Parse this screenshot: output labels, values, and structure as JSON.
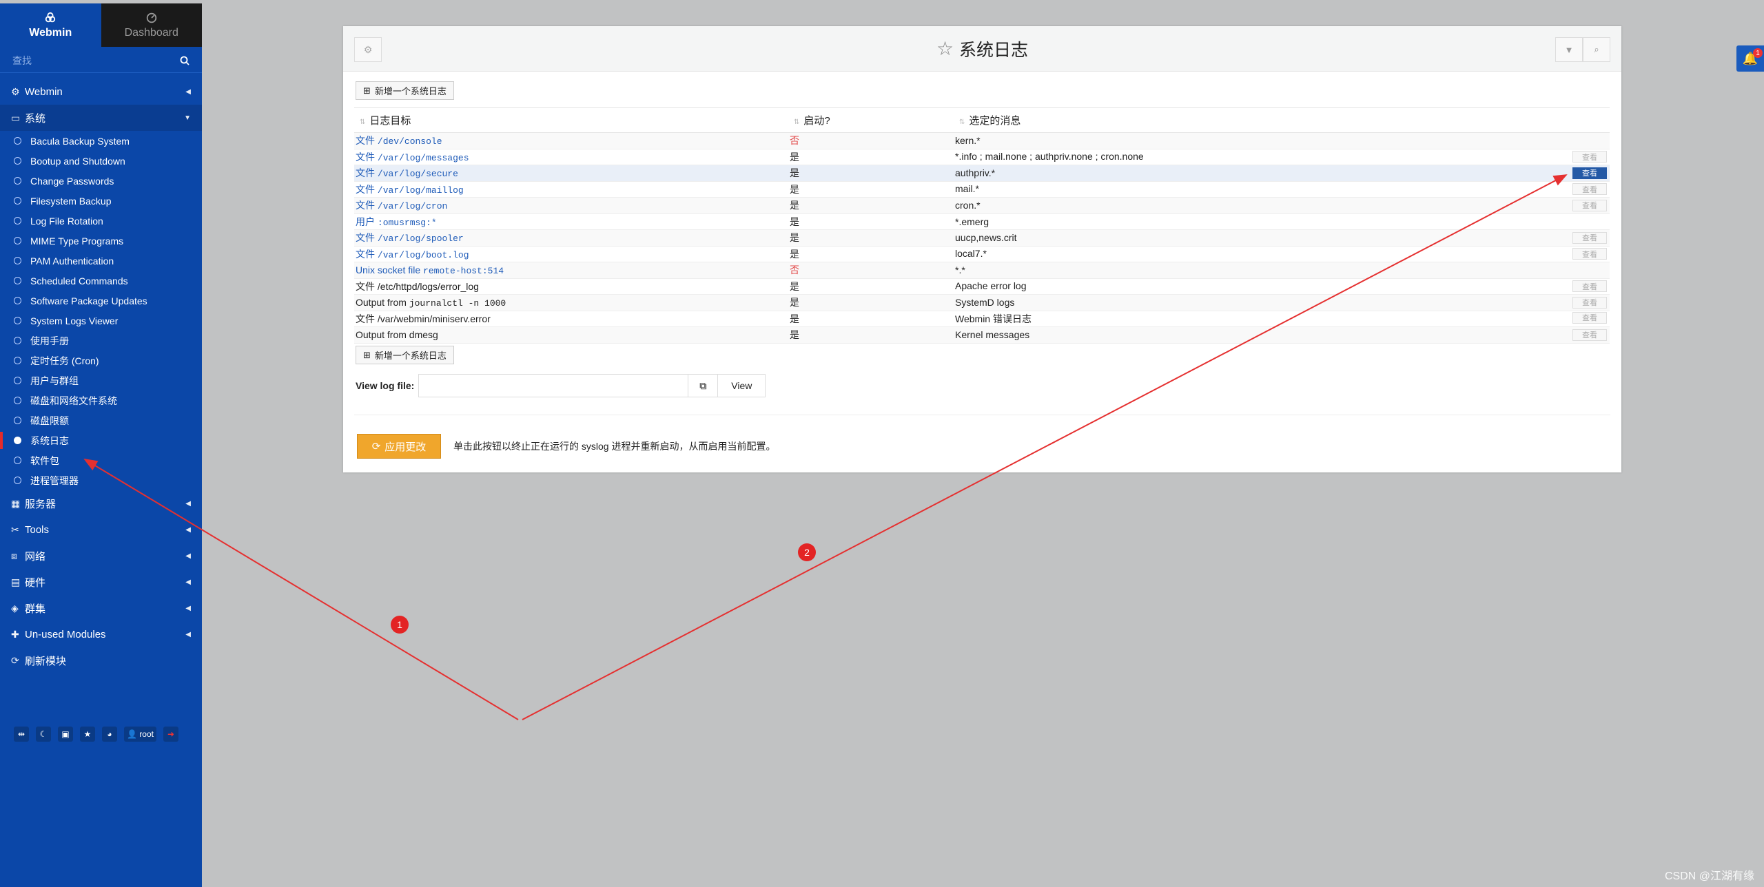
{
  "sidebar": {
    "tabs": [
      {
        "label": "Webmin"
      },
      {
        "label": "Dashboard"
      }
    ],
    "search_placeholder": "查找",
    "categories": [
      {
        "label": "Webmin",
        "icon": "gear-icon"
      },
      {
        "label": "系统",
        "icon": "monitor-icon"
      }
    ],
    "system_items": [
      {
        "label": "Bacula Backup System"
      },
      {
        "label": "Bootup and Shutdown"
      },
      {
        "label": "Change Passwords"
      },
      {
        "label": "Filesystem Backup"
      },
      {
        "label": "Log File Rotation"
      },
      {
        "label": "MIME Type Programs"
      },
      {
        "label": "PAM Authentication"
      },
      {
        "label": "Scheduled Commands"
      },
      {
        "label": "Software Package Updates"
      },
      {
        "label": "System Logs Viewer"
      },
      {
        "label": "使用手册"
      },
      {
        "label": "定时任务 (Cron)"
      },
      {
        "label": "用户与群组"
      },
      {
        "label": "磁盘和网络文件系统"
      },
      {
        "label": "磁盘限额"
      },
      {
        "label": "系统日志"
      },
      {
        "label": "软件包"
      },
      {
        "label": "进程管理器"
      }
    ],
    "other_categories": [
      {
        "label": "服务器",
        "icon": "server-icon"
      },
      {
        "label": "Tools",
        "icon": "tools-icon"
      },
      {
        "label": "网络",
        "icon": "network-icon"
      },
      {
        "label": "硬件",
        "icon": "hardware-icon"
      },
      {
        "label": "群集",
        "icon": "cluster-icon"
      },
      {
        "label": "Un-used Modules",
        "icon": "puzzle-icon"
      },
      {
        "label": "刷新模块",
        "icon": "refresh-icon"
      }
    ],
    "footer_user": "root"
  },
  "panel": {
    "title": "系统日志",
    "add_label": "新增一个系统日志",
    "columns": [
      "日志目标",
      "启动?",
      "选定的消息"
    ],
    "rows": [
      {
        "prefix": "文件",
        "target": "/dev/console",
        "enabled": "否",
        "messages": "kern.*",
        "view": ""
      },
      {
        "prefix": "文件",
        "target": "/var/log/messages",
        "enabled": "是",
        "messages": "*.info ; mail.none ; authpriv.none ; cron.none",
        "view": "查看"
      },
      {
        "prefix": "文件",
        "target": "/var/log/secure",
        "enabled": "是",
        "messages": "authpriv.*",
        "view": "查看"
      },
      {
        "prefix": "文件",
        "target": "/var/log/maillog",
        "enabled": "是",
        "messages": "mail.*",
        "view": "查看"
      },
      {
        "prefix": "文件",
        "target": "/var/log/cron",
        "enabled": "是",
        "messages": "cron.*",
        "view": "查看"
      },
      {
        "prefix": "用户",
        "target": ":omusrmsg:*",
        "enabled": "是",
        "messages": "*.emerg",
        "view": ""
      },
      {
        "prefix": "文件",
        "target": "/var/log/spooler",
        "enabled": "是",
        "messages": "uucp,news.crit",
        "view": "查看"
      },
      {
        "prefix": "文件",
        "target": "/var/log/boot.log",
        "enabled": "是",
        "messages": "local7.*",
        "view": "查看"
      },
      {
        "prefix": "Unix socket file",
        "target": "remote-host:514",
        "enabled": "否",
        "messages": "*.*",
        "view": ""
      },
      {
        "prefix": "文件 /etc/httpd/logs/error_log",
        "target": "",
        "enabled": "是",
        "messages": "Apache error log",
        "view": "查看"
      },
      {
        "prefix": "Output from",
        "target": "journalctl -n 1000",
        "enabled": "是",
        "messages": "SystemD logs",
        "view": "查看"
      },
      {
        "prefix": "文件 /var/webmin/miniserv.error",
        "target": "",
        "enabled": "是",
        "messages": "Webmin 错误日志",
        "view": "查看"
      },
      {
        "prefix": "Output from dmesg",
        "target": "",
        "enabled": "是",
        "messages": "Kernel messages",
        "view": "查看"
      }
    ],
    "view_log_label": "View log file:",
    "view_button": "View",
    "apply_label": "应用更改",
    "apply_note": "单击此按钮以终止正在运行的 syslog 进程并重新启动，从而启用当前配置。"
  },
  "notification_count": "1",
  "annotations": [
    "1",
    "2"
  ],
  "watermark": "CSDN @江湖有缘",
  "colors": {
    "sidebar": "#0b47a8",
    "accent": "#f0a62c",
    "arrow": "#e53030",
    "link": "#1d5ab8"
  }
}
